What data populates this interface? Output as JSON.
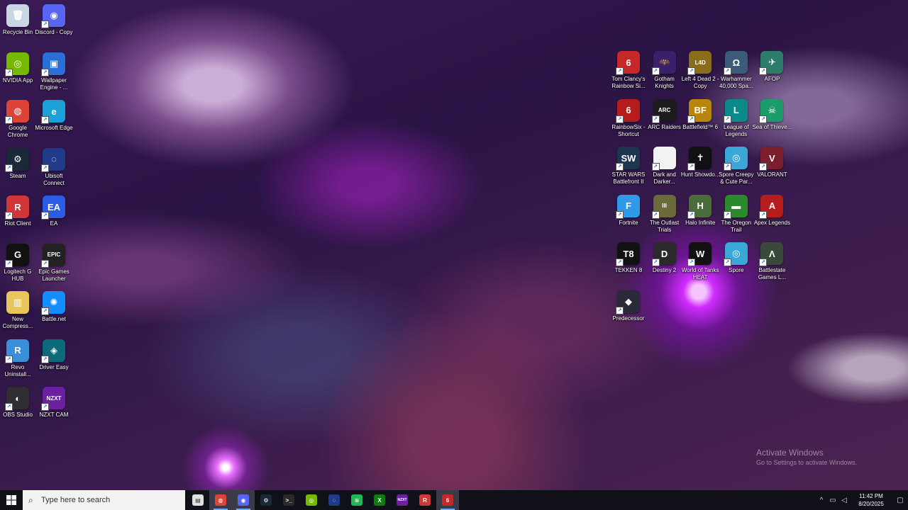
{
  "desktop_icons_left": [
    {
      "label": "Recycle Bin",
      "icon": "recycle-bin-icon",
      "color": "#c9d6e4",
      "glyph": "🗑",
      "shortcut": false
    },
    {
      "label": "Discord - Copy",
      "icon": "discord-icon",
      "color": "#5865f2",
      "glyph": "◉",
      "shortcut": true
    },
    {
      "label": "NVIDIA App",
      "icon": "nvidia-icon",
      "color": "#76b900",
      "glyph": "◎",
      "shortcut": true
    },
    {
      "label": "Wallpaper Engine - ...",
      "icon": "wallpaper-engine-icon",
      "color": "#2a6fd6",
      "glyph": "▣",
      "shortcut": true
    },
    {
      "label": "Google Chrome",
      "icon": "chrome-icon",
      "color": "#db4437",
      "glyph": "◍",
      "shortcut": true
    },
    {
      "label": "Microsoft Edge",
      "icon": "edge-icon",
      "color": "#1ba0d8",
      "glyph": "e",
      "shortcut": true
    },
    {
      "label": "Steam",
      "icon": "steam-icon",
      "color": "#1b2838",
      "glyph": "⚙",
      "shortcut": true
    },
    {
      "label": "Ubisoft Connect",
      "icon": "ubisoft-icon",
      "color": "#1f3b8a",
      "glyph": "◌",
      "shortcut": true
    },
    {
      "label": "Riot Client",
      "icon": "riot-client-icon",
      "color": "#d13639",
      "glyph": "R",
      "shortcut": true
    },
    {
      "label": "EA",
      "icon": "ea-icon",
      "color": "#2b5ce6",
      "glyph": "EA",
      "shortcut": true
    },
    {
      "label": "Logitech G HUB",
      "icon": "logitech-icon",
      "color": "#111111",
      "glyph": "G",
      "shortcut": true
    },
    {
      "label": "Epic Games Launcher",
      "icon": "epic-games-icon",
      "color": "#222222",
      "glyph": "EPIC",
      "shortcut": true
    },
    {
      "label": "New Compress...",
      "icon": "zip-folder-icon",
      "color": "#e8c65c",
      "glyph": "▥",
      "shortcut": false
    },
    {
      "label": "Battle.net",
      "icon": "battlenet-icon",
      "color": "#148eff",
      "glyph": "✺",
      "shortcut": true
    },
    {
      "label": "Revo Uninstall...",
      "icon": "revo-uninstaller-icon",
      "color": "#3a8fd9",
      "glyph": "R",
      "shortcut": true
    },
    {
      "label": "Driver Easy",
      "icon": "driver-easy-icon",
      "color": "#0b6b7a",
      "glyph": "◈",
      "shortcut": true
    },
    {
      "label": "OBS Studio",
      "icon": "obs-icon",
      "color": "#302e31",
      "glyph": "◐",
      "shortcut": true
    },
    {
      "label": "NZXT CAM",
      "icon": "nzxt-cam-icon",
      "color": "#6a20a0",
      "glyph": "NZXT",
      "shortcut": true
    }
  ],
  "desktop_icons_right": [
    {
      "label": "Tom Clancy's Rainbow Si...",
      "icon": "rainbow-six-icon",
      "color": "#c62828",
      "glyph": "6",
      "shortcut": true
    },
    {
      "label": "Gotham Knights",
      "icon": "gotham-knights-icon",
      "color": "#3a1f6b",
      "glyph": "🦇",
      "shortcut": true
    },
    {
      "label": "Left 4 Dead 2 - Copy",
      "icon": "left4dead-icon",
      "color": "#8a6d1a",
      "glyph": "L4D",
      "shortcut": true
    },
    {
      "label": "Warhammer 40,000 Spa...",
      "icon": "warhammer-icon",
      "color": "#3b5b7a",
      "glyph": "Ω",
      "shortcut": true
    },
    {
      "label": "AFOP",
      "icon": "afop-icon",
      "color": "#2e7d6a",
      "glyph": "✈",
      "shortcut": true
    },
    {
      "label": "RainbowSix - Shortcut",
      "icon": "rainbow-six-shortcut-icon",
      "color": "#b71c1c",
      "glyph": "6",
      "shortcut": true
    },
    {
      "label": "ARC Raiders",
      "icon": "arc-raiders-icon",
      "color": "#1c1c1c",
      "glyph": "ARC",
      "shortcut": true
    },
    {
      "label": "Battlefield™ 6",
      "icon": "battlefield6-icon",
      "color": "#b8860b",
      "glyph": "BF",
      "shortcut": true
    },
    {
      "label": "League of Legends",
      "icon": "league-of-legends-icon",
      "color": "#0a8a8a",
      "glyph": "L",
      "shortcut": true
    },
    {
      "label": "Sea of Thieve...",
      "icon": "sea-of-thieves-icon",
      "color": "#1b9c6a",
      "glyph": "☠",
      "shortcut": true
    },
    {
      "label": "STAR WARS Battlefront II",
      "icon": "star-wars-icon",
      "color": "#1e3552",
      "glyph": "SW",
      "shortcut": true
    },
    {
      "label": "Dark and Darker...",
      "icon": "dark-and-darker-icon",
      "color": "#f2f2f2",
      "glyph": "",
      "shortcut": true
    },
    {
      "label": "Hunt Showdo...",
      "icon": "hunt-showdown-icon",
      "color": "#111111",
      "glyph": "✝",
      "shortcut": true
    },
    {
      "label": "Spore Creepy & Cute Par...",
      "icon": "spore-creepy-icon",
      "color": "#3aa7d6",
      "glyph": "◎",
      "shortcut": true
    },
    {
      "label": "VALORANT",
      "icon": "valorant-icon",
      "color": "#7a1f2b",
      "glyph": "V",
      "shortcut": true
    },
    {
      "label": "Fortnite",
      "icon": "fortnite-icon",
      "color": "#2f9be8",
      "glyph": "F",
      "shortcut": true
    },
    {
      "label": "The Outlast Trials",
      "icon": "outlast-icon",
      "color": "#6a6a3a",
      "glyph": "III",
      "shortcut": true
    },
    {
      "label": "Halo Infinite",
      "icon": "halo-icon",
      "color": "#4a6b3a",
      "glyph": "H",
      "shortcut": true
    },
    {
      "label": "The Oregon Trail",
      "icon": "oregon-trail-icon",
      "color": "#2b8a2b",
      "glyph": "▬",
      "shortcut": true
    },
    {
      "label": "Apex Legends",
      "icon": "apex-legends-icon",
      "color": "#b71c1c",
      "glyph": "A",
      "shortcut": true
    },
    {
      "label": "TEKKEN 8",
      "icon": "tekken-icon",
      "color": "#111111",
      "glyph": "T8",
      "shortcut": true
    },
    {
      "label": "Destiny 2",
      "icon": "destiny-icon",
      "color": "#2a2a2a",
      "glyph": "D",
      "shortcut": true
    },
    {
      "label": "World of Tanks HEAT",
      "icon": "world-of-tanks-icon",
      "color": "#111111",
      "glyph": "W",
      "shortcut": true
    },
    {
      "label": "Spore",
      "icon": "spore-icon",
      "color": "#3aa7d6",
      "glyph": "◎",
      "shortcut": true
    },
    {
      "label": "Battlestate Games L...",
      "icon": "battlestate-icon",
      "color": "#3a4a3a",
      "glyph": "Λ",
      "shortcut": true
    },
    {
      "label": "Predecessor",
      "icon": "predecessor-icon",
      "color": "#2a2a3a",
      "glyph": "◆",
      "shortcut": true
    }
  ],
  "activation": {
    "title": "Activate Windows",
    "subtitle": "Go to Settings to activate Windows."
  },
  "taskbar": {
    "search_placeholder": "Type here to search",
    "apps": [
      {
        "name": "taskbar-task-view",
        "icon": "task-view-icon",
        "color": "#e0e0e0",
        "glyph": "▤",
        "active": false
      },
      {
        "name": "taskbar-chrome",
        "icon": "chrome-icon",
        "color": "#db4437",
        "glyph": "◍",
        "active": true
      },
      {
        "name": "taskbar-discord",
        "icon": "discord-icon",
        "color": "#5865f2",
        "glyph": "◉",
        "active": true
      },
      {
        "name": "taskbar-steam",
        "icon": "steam-icon",
        "color": "#1b2838",
        "glyph": "⚙",
        "active": false
      },
      {
        "name": "taskbar-file-explorer",
        "icon": "terminal-icon",
        "color": "#2a2a2a",
        "glyph": ">_",
        "active": false
      },
      {
        "name": "taskbar-nvidia",
        "icon": "nvidia-icon",
        "color": "#76b900",
        "glyph": "◎",
        "active": false
      },
      {
        "name": "taskbar-ubisoft",
        "icon": "ubisoft-icon",
        "color": "#1f3b8a",
        "glyph": "◌",
        "active": false
      },
      {
        "name": "taskbar-spotify",
        "icon": "spotify-icon",
        "color": "#1db954",
        "glyph": "≋",
        "active": false
      },
      {
        "name": "taskbar-xbox",
        "icon": "xbox-icon",
        "color": "#107c10",
        "glyph": "X",
        "active": false
      },
      {
        "name": "taskbar-nzxt",
        "icon": "nzxt-icon",
        "color": "#6a20a0",
        "glyph": "NZXT",
        "active": false
      },
      {
        "name": "taskbar-riot",
        "icon": "riot-icon",
        "color": "#d13639",
        "glyph": "R",
        "active": false
      },
      {
        "name": "taskbar-rainbow-six",
        "icon": "rainbow-six-icon",
        "color": "#c62828",
        "glyph": "6",
        "active": true
      }
    ],
    "time": "11:42 PM",
    "date": "8/20/2025"
  }
}
